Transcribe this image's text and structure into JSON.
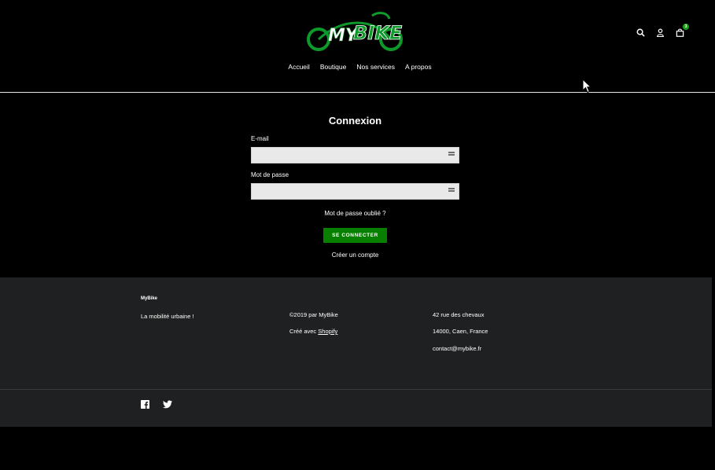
{
  "header": {
    "logo_alt": "MyBike",
    "nav": [
      "Accueil",
      "Boutique",
      "Nos services",
      "A propos"
    ],
    "cart_count": "3",
    "icons": [
      "search-icon",
      "account-icon",
      "cart-icon"
    ]
  },
  "login": {
    "title": "Connexion",
    "email_label": "E-mail",
    "email_value": "",
    "password_label": "Mot de passe",
    "password_value": "",
    "forgot_link": "Mot de passe oublié ?",
    "submit_label": "SE CONNECTER",
    "create_link": "Créer un compte"
  },
  "footer": {
    "brand": "MyBike",
    "tagline": "La mobilité urbaine !",
    "copyright": "©2019 par MyBike",
    "created_prefix": "Créé avec",
    "created_link": "Shopify",
    "address_line1": "42 rue des chevaux",
    "address_line2": "14000, Caen, France",
    "email": "contact@mybike.fr",
    "social": [
      "facebook-icon",
      "twitter-icon"
    ]
  },
  "colors": {
    "background": "#000000",
    "footer_bg": "#1f2021",
    "button_bg": "#078000",
    "logo_green": "#0d9a2a"
  }
}
